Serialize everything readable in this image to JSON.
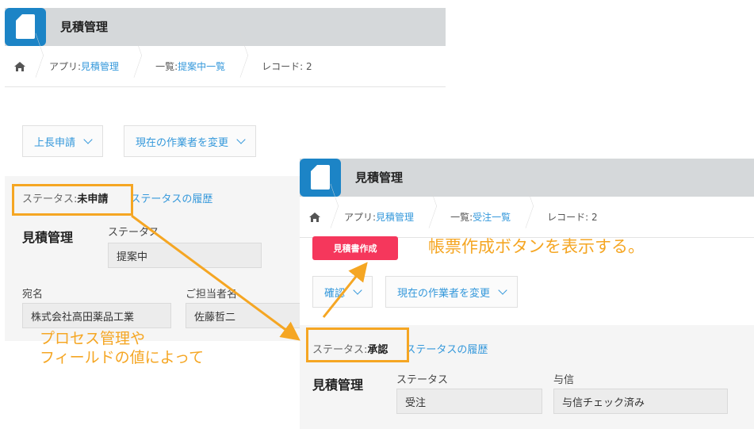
{
  "app_title": "見積管理",
  "panel_a": {
    "breadcrumb": {
      "app_prefix": "アプリ: ",
      "app_name": "見積管理",
      "list_prefix": "一覧: ",
      "list_name": "提案中一覧",
      "record": "レコード: 2"
    },
    "action_button": "上長申請",
    "assignee_button": "現在の作業者を変更",
    "status_label": "ステータス: ",
    "status_value": "未申請",
    "status_history": "ステータスの履歴",
    "group_title": "見積管理",
    "fields": {
      "status_label": "ステータス",
      "status_value": "提案中",
      "addressee_label": "宛名",
      "addressee_value": "株式会社高田薬品工業",
      "contact_label": "ご担当者名",
      "contact_value": "佐藤哲二"
    }
  },
  "panel_b": {
    "breadcrumb": {
      "app_prefix": "アプリ: ",
      "app_name": "見積管理",
      "list_prefix": "一覧: ",
      "list_name": "受注一覧",
      "record": "レコード: 2"
    },
    "pdf_button": "見積書作成",
    "action_button": "確認",
    "assignee_button": "現在の作業者を変更",
    "status_label": "ステータス: ",
    "status_value": "承認",
    "status_history": "ステータスの履歴",
    "group_title": "見積管理",
    "fields": {
      "status_label": "ステータス",
      "status_value": "受注",
      "credit_label": "与信",
      "credit_value": "与信チェック済み"
    }
  },
  "annotations": {
    "condition_line1": "プロセス管理や",
    "condition_line2": "フィールドの値によって",
    "result": "帳票作成ボタンを表示する。"
  },
  "colors": {
    "app_icon": "#1c84c6",
    "link": "#3498db",
    "highlight": "#f5a623",
    "pdf_button": "#f5375c"
  },
  "icons": [
    "document-icon",
    "home-icon",
    "chevron-down-icon"
  ]
}
